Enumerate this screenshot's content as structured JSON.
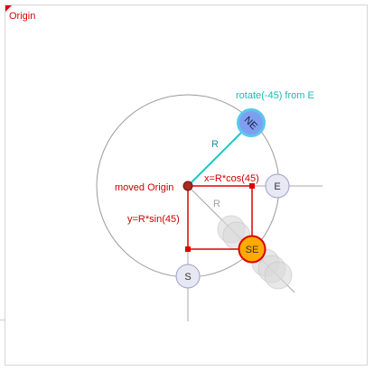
{
  "labels": {
    "origin": "Origin",
    "moved_origin": "moved Origin",
    "rotate_note": "rotate(-45) from E",
    "radius_primary": "R",
    "radius_secondary": "R",
    "x_formula": "x=R*cos(45)",
    "y_formula": "y=R*sin(45)"
  },
  "nodes": {
    "ne": "NE",
    "e": "E",
    "se": "SE",
    "s": "S"
  },
  "colors": {
    "red": "#dd0000",
    "teal": "#1cc6c6",
    "gray_line": "#a8a8a8",
    "circle": "#9a9a9a",
    "ne_fill": "#7f9ef0",
    "ne_stroke": "#59c8ec",
    "se_fill": "#ffaa00",
    "se_stroke": "#dd0000",
    "node_fill": "#e6e8f4",
    "node_stroke": "#9aa0c8",
    "ghost": "#d8d8d8"
  }
}
